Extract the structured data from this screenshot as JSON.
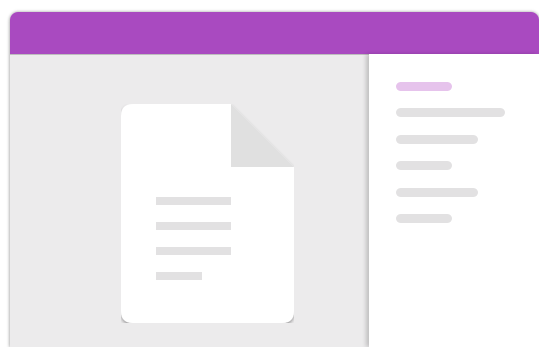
{
  "colors": {
    "accent": "#a94ac0",
    "accent_light": "#e6c3ec",
    "pane_background": "#ecebec",
    "document_fold": "#e0e0e0",
    "line_placeholder": "#e2e1e2",
    "page_background": "#ffffff"
  },
  "icons": {
    "document": "document-icon"
  }
}
